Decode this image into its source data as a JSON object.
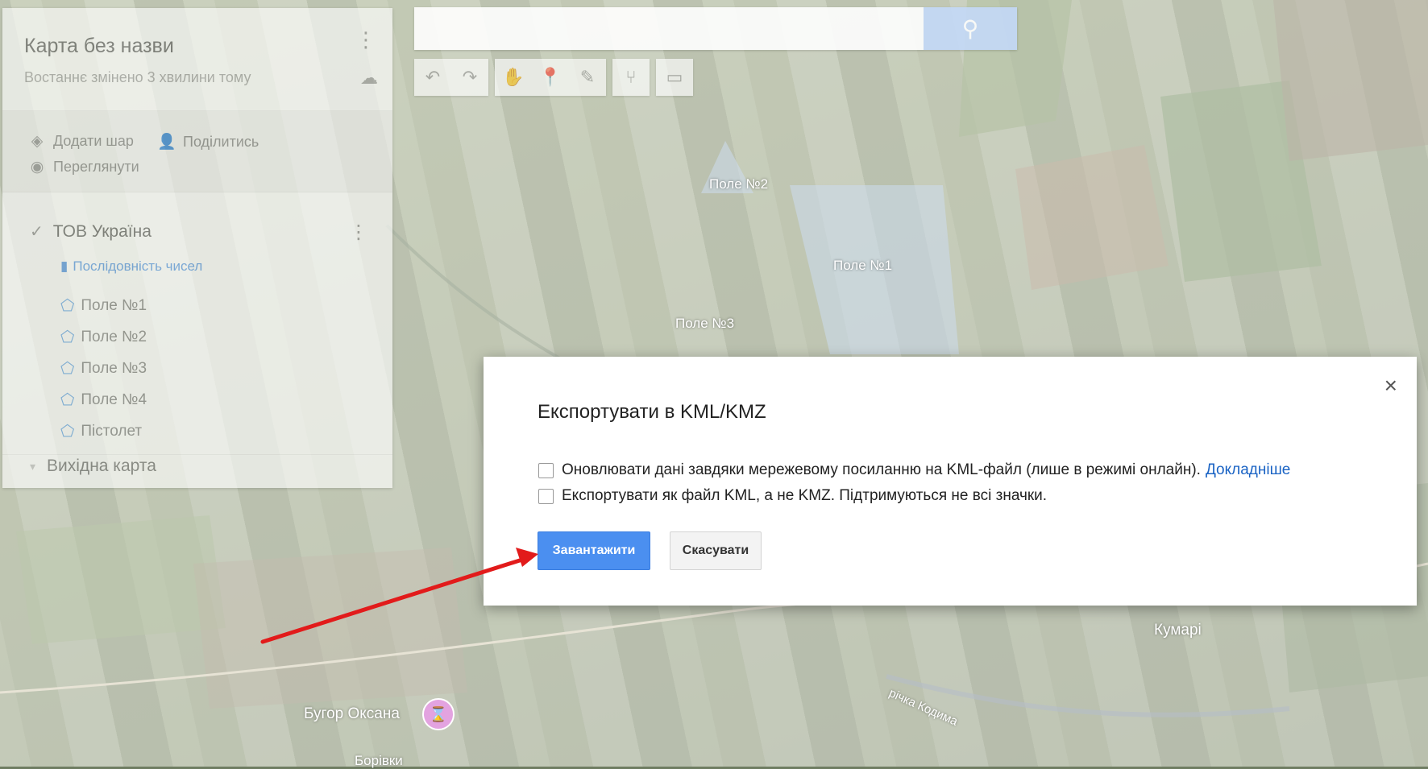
{
  "map": {
    "place_labels": [
      "Кумарі",
      "Бугор Оксана",
      "Борівки"
    ],
    "river_label": "річка Кодима",
    "field_labels": [
      "Поле №2",
      "Поле №1",
      "Поле №3"
    ]
  },
  "side_panel": {
    "title": "Карта без назви",
    "subtitle": "Востаннє змінено 3 хвилини тому",
    "actions": {
      "add_layer": "Додати шар",
      "share": "Поділитись",
      "preview": "Переглянути"
    },
    "layer": {
      "title": "ТОВ Україна",
      "style": "Послідовність чисел",
      "features": [
        "Поле №1",
        "Поле №2",
        "Поле №3",
        "Поле №4",
        "Пістолет"
      ]
    },
    "base_map": "Вихідна карта"
  },
  "search": {
    "placeholder": ""
  },
  "dialog": {
    "title": "Експортувати в KML/KMZ",
    "option1": "Оновлювати дані завдяки мережевому посиланню на KML-файл (лише в режимі онлайн).",
    "option1_link": "Докладніше",
    "option2": "Експортувати як файл KML, а не KMZ. Підтримуються не всі значки.",
    "download_button": "Завантажити",
    "cancel_button": "Скасувати"
  },
  "colors": {
    "primary_button": "#4b8ff0",
    "link": "#1a63c4",
    "annotation_arrow": "#e21b1b"
  },
  "icons": [
    "search-icon",
    "undo-icon",
    "redo-icon",
    "hand-icon",
    "marker-icon",
    "draw-line-icon",
    "directions-icon",
    "ruler-icon",
    "close-icon",
    "layers-icon",
    "add-person-icon",
    "eye-icon",
    "cloud-icon",
    "checkbox-icon",
    "paint-roller-icon",
    "polygon-icon"
  ]
}
